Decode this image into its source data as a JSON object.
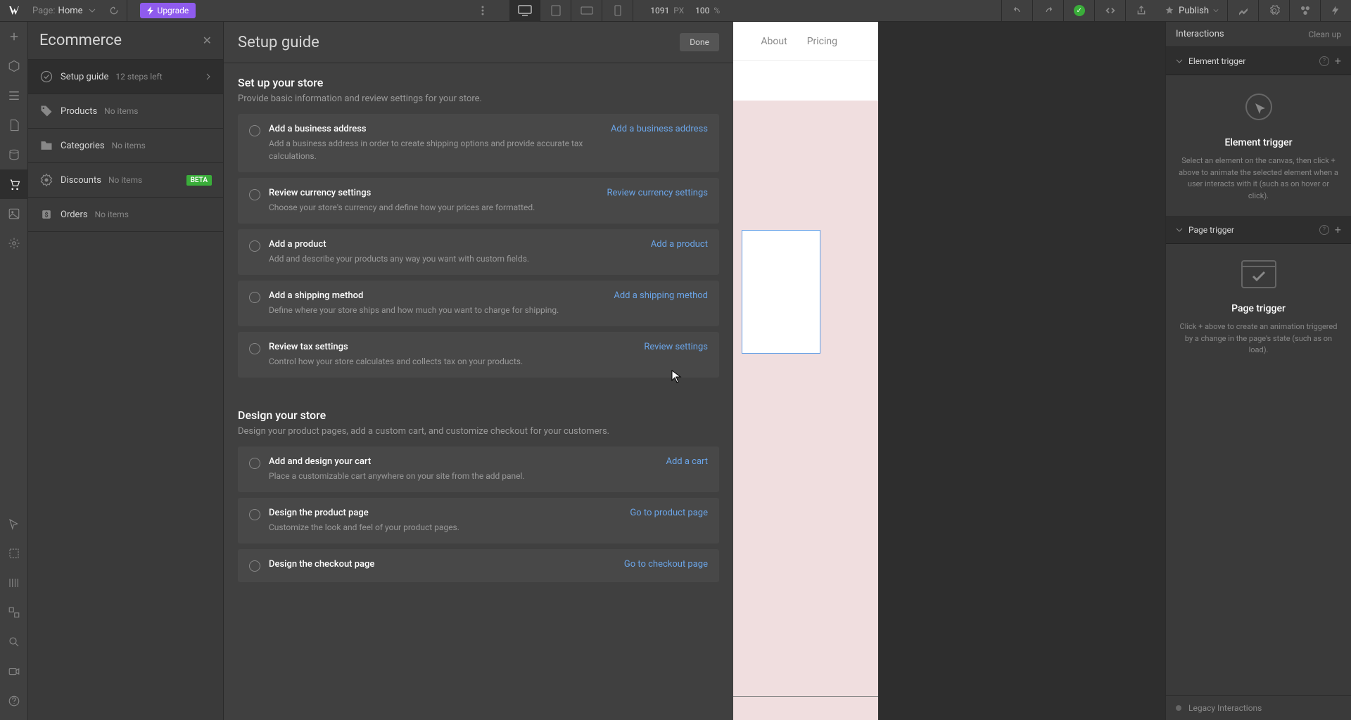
{
  "topbar": {
    "page_label": "Page:",
    "page_name": "Home",
    "upgrade": "Upgrade",
    "canvas_width": "1091",
    "canvas_unit": "PX",
    "zoom": "100",
    "zoom_unit": "%",
    "publish": "Publish"
  },
  "ecommerce": {
    "title": "Ecommerce",
    "nav": {
      "setup_guide": "Setup guide",
      "setup_steps": "12 steps left",
      "products": "Products",
      "products_meta": "No items",
      "categories": "Categories",
      "categories_meta": "No items",
      "discounts": "Discounts",
      "discounts_meta": "No items",
      "discounts_badge": "BETA",
      "orders": "Orders",
      "orders_meta": "No items"
    }
  },
  "guide": {
    "title": "Setup guide",
    "done": "Done",
    "sections": [
      {
        "title": "Set up your store",
        "desc": "Provide basic information and review settings for your store.",
        "steps": [
          {
            "title": "Add a business address",
            "desc": "Add a business address in order to create shipping options and provide accurate tax calculations.",
            "action": "Add a business address"
          },
          {
            "title": "Review currency settings",
            "desc": "Choose your store's currency and define how your prices are formatted.",
            "action": "Review currency settings"
          },
          {
            "title": "Add a product",
            "desc": "Add and describe your products any way you want with custom fields.",
            "action": "Add a product"
          },
          {
            "title": "Add a shipping method",
            "desc": "Define where your store ships and how much you want to charge for shipping.",
            "action": "Add a shipping method"
          },
          {
            "title": "Review tax settings",
            "desc": "Control how your store calculates and collects tax on your products.",
            "action": "Review settings"
          }
        ]
      },
      {
        "title": "Design your store",
        "desc": "Design your product pages, add a custom cart, and customize checkout for your customers.",
        "steps": [
          {
            "title": "Add and design your cart",
            "desc": "Place a customizable cart anywhere on your site from the add panel.",
            "action": "Add a cart"
          },
          {
            "title": "Design the product page",
            "desc": "Customize the look and feel of your product pages.",
            "action": "Go to product page"
          },
          {
            "title": "Design the checkout page",
            "desc": "",
            "action": "Go to checkout page"
          }
        ]
      }
    ]
  },
  "canvas_nav": {
    "about": "About",
    "pricing": "Pricing"
  },
  "interactions": {
    "header": "Interactions",
    "clean_up": "Clean up",
    "element_trigger_label": "Element trigger",
    "element_trigger_title": "Element trigger",
    "element_trigger_desc": "Select an element on the canvas, then click + above to animate the selected element when a user interacts with it (such as on hover or click).",
    "page_trigger_label": "Page trigger",
    "page_trigger_title": "Page trigger",
    "page_trigger_desc": "Click + above to create an animation triggered by a change in the page's state (such as on load).",
    "legacy": "Legacy Interactions"
  }
}
